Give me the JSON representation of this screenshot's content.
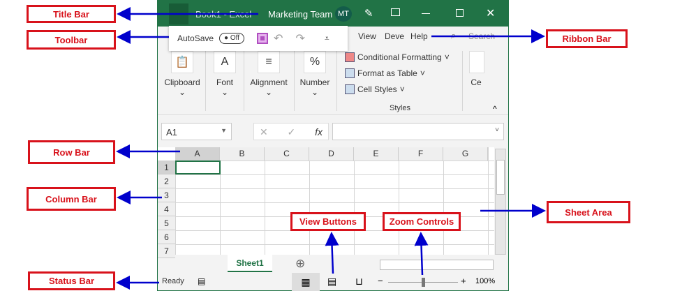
{
  "callouts": {
    "title_bar": "Title Bar",
    "toolbar": "Toolbar",
    "row_bar": "Row Bar",
    "column_bar": "Column Bar",
    "status_bar": "Status Bar",
    "ribbon_bar": "Ribbon Bar",
    "sheet_area": "Sheet Area",
    "view_buttons": "View Buttons",
    "zoom_controls": "Zoom Controls"
  },
  "colors": {
    "excel_green": "#217346",
    "callout_red": "#d8121b",
    "arrow_blue": "#0000cc"
  },
  "title": {
    "doc": "Book1 - Excel",
    "team": "Marketing Team",
    "avatar": "MT"
  },
  "qat": {
    "autosave": "AutoSave",
    "toggle": "Off"
  },
  "tabs": [
    "View",
    "Deve",
    "Help"
  ],
  "search": "Search",
  "ribbon": {
    "groups": [
      "Clipboard",
      "Font",
      "Alignment",
      "Number",
      "Ce"
    ],
    "icons": [
      "",
      "A",
      "≡",
      "%",
      ""
    ],
    "styles": [
      "Conditional Formatting",
      "Format as Table",
      "Cell Styles"
    ],
    "styles_label": "Styles"
  },
  "formula": {
    "namebox": "A1",
    "fx": "fx"
  },
  "columns": [
    "A",
    "B",
    "C",
    "D",
    "E",
    "F",
    "G"
  ],
  "rows": [
    "1",
    "2",
    "3",
    "4",
    "5",
    "6",
    "7"
  ],
  "sheet_tab": "Sheet1",
  "status": {
    "ready": "Ready",
    "zoom": "100%"
  }
}
